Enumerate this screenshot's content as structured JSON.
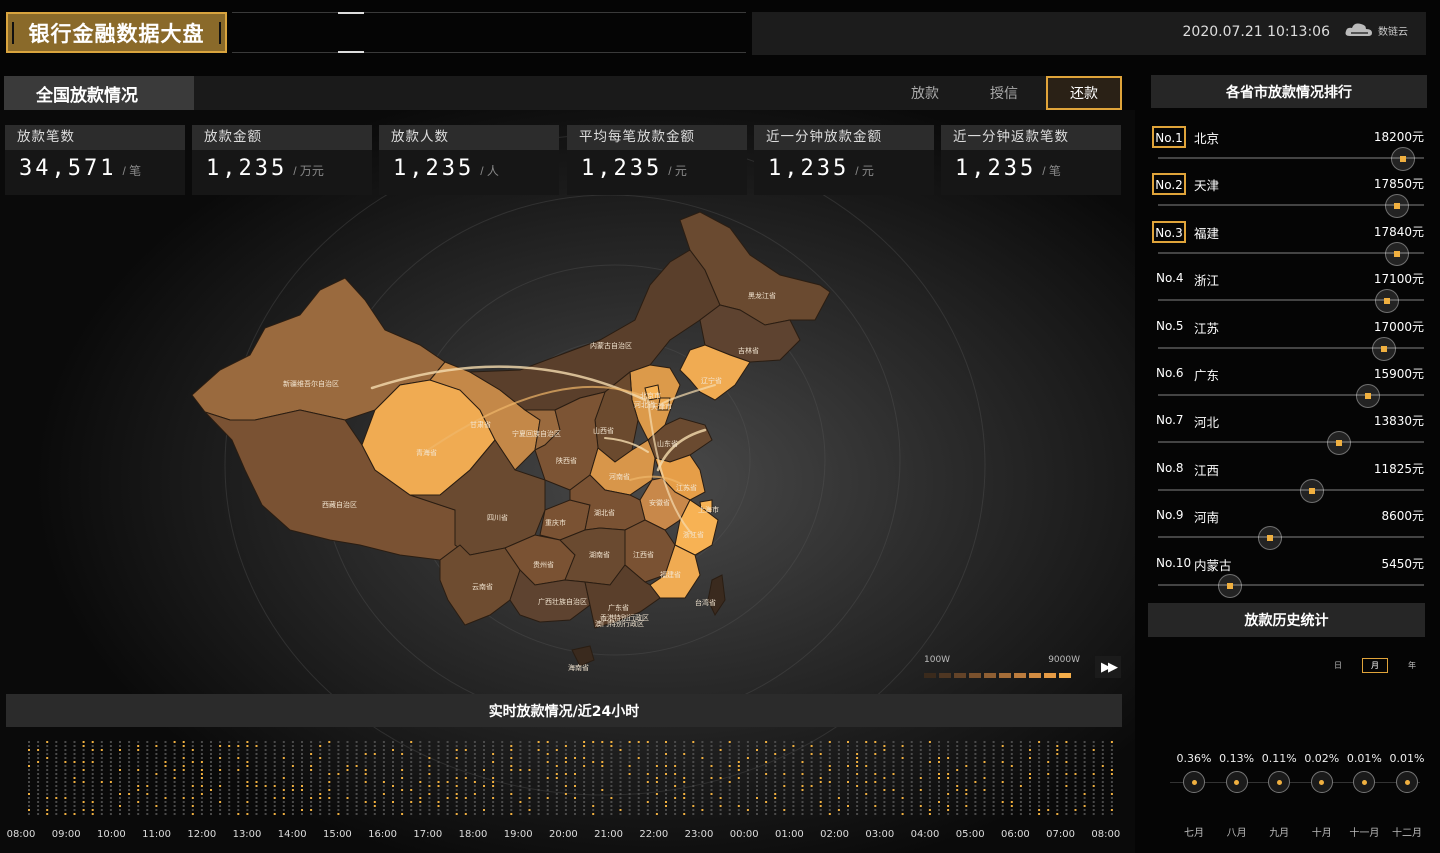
{
  "header": {
    "title": "银行金融数据大盘",
    "datetime": "2020.07.21 10:13:06",
    "logo_text": "数链云"
  },
  "loan_panel": {
    "title": "全国放款情况",
    "tabs": [
      {
        "label": "放款",
        "active": false
      },
      {
        "label": "授信",
        "active": false
      },
      {
        "label": "还款",
        "active": true
      }
    ]
  },
  "stats": [
    {
      "label": "放款笔数",
      "value": "34,571",
      "unit": "/ 笔"
    },
    {
      "label": "放款金额",
      "value": "1,235",
      "unit": "/ 万元"
    },
    {
      "label": "放款人数",
      "value": "1,235",
      "unit": "/ 人"
    },
    {
      "label": "平均每笔放款金额",
      "value": "1,235",
      "unit": "/ 元"
    },
    {
      "label": "近一分钟放款金额",
      "value": "1,235",
      "unit": "/ 元"
    },
    {
      "label": "近一分钟返款笔数",
      "value": "1,235",
      "unit": "/ 笔"
    }
  ],
  "map": {
    "provinces": [
      "新疆维吾尔自治区",
      "西藏自治区",
      "青海省",
      "甘肃省",
      "内蒙古自治区",
      "黑龙江省",
      "吉林省",
      "辽宁省",
      "北京市",
      "河北省",
      "天津市",
      "山西省",
      "宁夏回族自治区",
      "陕西省",
      "山东省",
      "河南省",
      "江苏省",
      "安徽省",
      "上海市",
      "四川省",
      "重庆市",
      "湖北省",
      "浙江省",
      "云南省",
      "贵州省",
      "湖南省",
      "江西省",
      "福建省",
      "台湾省",
      "广西壮族自治区",
      "广东省",
      "香港特别行政区",
      "澳门特别行政区",
      "海南省"
    ]
  },
  "legend": {
    "min_label": "100W",
    "max_label": "9000W",
    "colors": [
      "#3a2a1c",
      "#4e3622",
      "#634328",
      "#7a512d",
      "#8f5f33",
      "#a56d38",
      "#bc7c3d",
      "#d28c42",
      "#e69b45",
      "#f5ae4a"
    ]
  },
  "play_button": {
    "icon": "fast-forward-icon",
    "glyph": "▶▶"
  },
  "realtime": {
    "title": "实时放款情况/近24小时",
    "time_labels": [
      "08:00",
      "09:00",
      "10:00",
      "11:00",
      "12:00",
      "13:00",
      "14:00",
      "15:00",
      "16:00",
      "17:00",
      "18:00",
      "19:00",
      "20:00",
      "21:00",
      "22:00",
      "23:00",
      "00:00",
      "01:00",
      "02:00",
      "03:00",
      "04:00",
      "05:00",
      "06:00",
      "07:00",
      "08:00"
    ]
  },
  "ranking": {
    "title": "各省市放款情况排行",
    "items": [
      {
        "rank": "No.1",
        "name": "北京",
        "amount": "18200元",
        "level": 0.92,
        "boxed": true
      },
      {
        "rank": "No.2",
        "name": "天津",
        "amount": "17850元",
        "level": 0.9,
        "boxed": true
      },
      {
        "rank": "No.3",
        "name": "福建",
        "amount": "17840元",
        "level": 0.9,
        "boxed": true
      },
      {
        "rank": "No.4",
        "name": "浙江",
        "amount": "17100元",
        "level": 0.86,
        "boxed": false
      },
      {
        "rank": "No.5",
        "name": "江苏",
        "amount": "17000元",
        "level": 0.85,
        "boxed": false
      },
      {
        "rank": "No.6",
        "name": "广东",
        "amount": "15900元",
        "level": 0.79,
        "boxed": false
      },
      {
        "rank": "No.7",
        "name": "河北",
        "amount": "13830元",
        "level": 0.68,
        "boxed": false
      },
      {
        "rank": "No.8",
        "name": "江西",
        "amount": "11825元",
        "level": 0.58,
        "boxed": false
      },
      {
        "rank": "No.9",
        "name": "河南",
        "amount": "8600元",
        "level": 0.42,
        "boxed": false
      },
      {
        "rank": "No.10",
        "name": "内蒙古",
        "amount": "5450元",
        "level": 0.27,
        "boxed": false
      }
    ]
  },
  "history": {
    "title": "放款历史统计",
    "periods": [
      {
        "label": "日",
        "active": false
      },
      {
        "label": "月",
        "active": true
      },
      {
        "label": "年",
        "active": false
      }
    ],
    "points": [
      {
        "month": "七月",
        "pct": "0.36%"
      },
      {
        "month": "八月",
        "pct": "0.13%"
      },
      {
        "month": "九月",
        "pct": "0.11%"
      },
      {
        "month": "十月",
        "pct": "0.02%"
      },
      {
        "month": "十一月",
        "pct": "0.01%"
      },
      {
        "month": "十二月",
        "pct": "0.01%"
      }
    ]
  }
}
